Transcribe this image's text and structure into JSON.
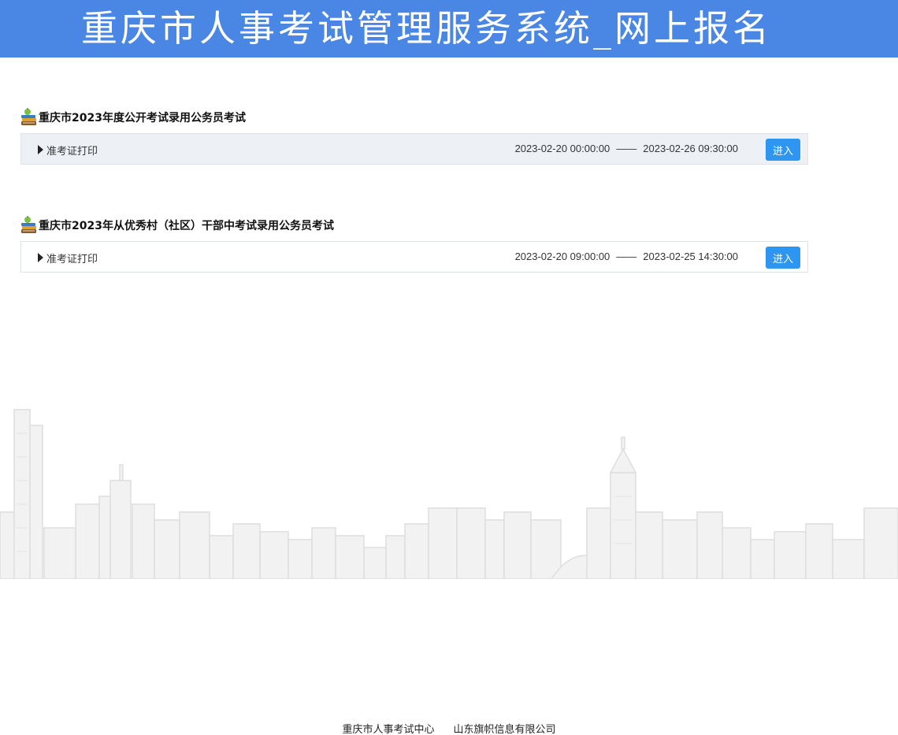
{
  "header": {
    "title": "重庆市人事考试管理服务系统_网上报名"
  },
  "exams": [
    {
      "title": "重庆市2023年度公开考试录用公务员考试",
      "item": "准考证打印",
      "start": "2023-02-20 00:00:00",
      "end": "2023-02-26 09:30:00",
      "dash": "——",
      "button": "进入"
    },
    {
      "title": "重庆市2023年从优秀村（社区）干部中考试录用公务员考试",
      "item": "准考证打印",
      "start": "2023-02-20 09:00:00",
      "end": "2023-02-25 14:30:00",
      "dash": "——",
      "button": "进入"
    }
  ],
  "footer": {
    "left": "重庆市人事考试中心",
    "right": "山东旗帜信息有限公司"
  },
  "colors": {
    "header_bg": "#4a86e3",
    "button_bg": "#2e95f0",
    "row_shaded": "#edf1f5"
  },
  "icons": [
    "book-stack-icon",
    "triangle-right-icon",
    "city-skyline-illustration"
  ]
}
